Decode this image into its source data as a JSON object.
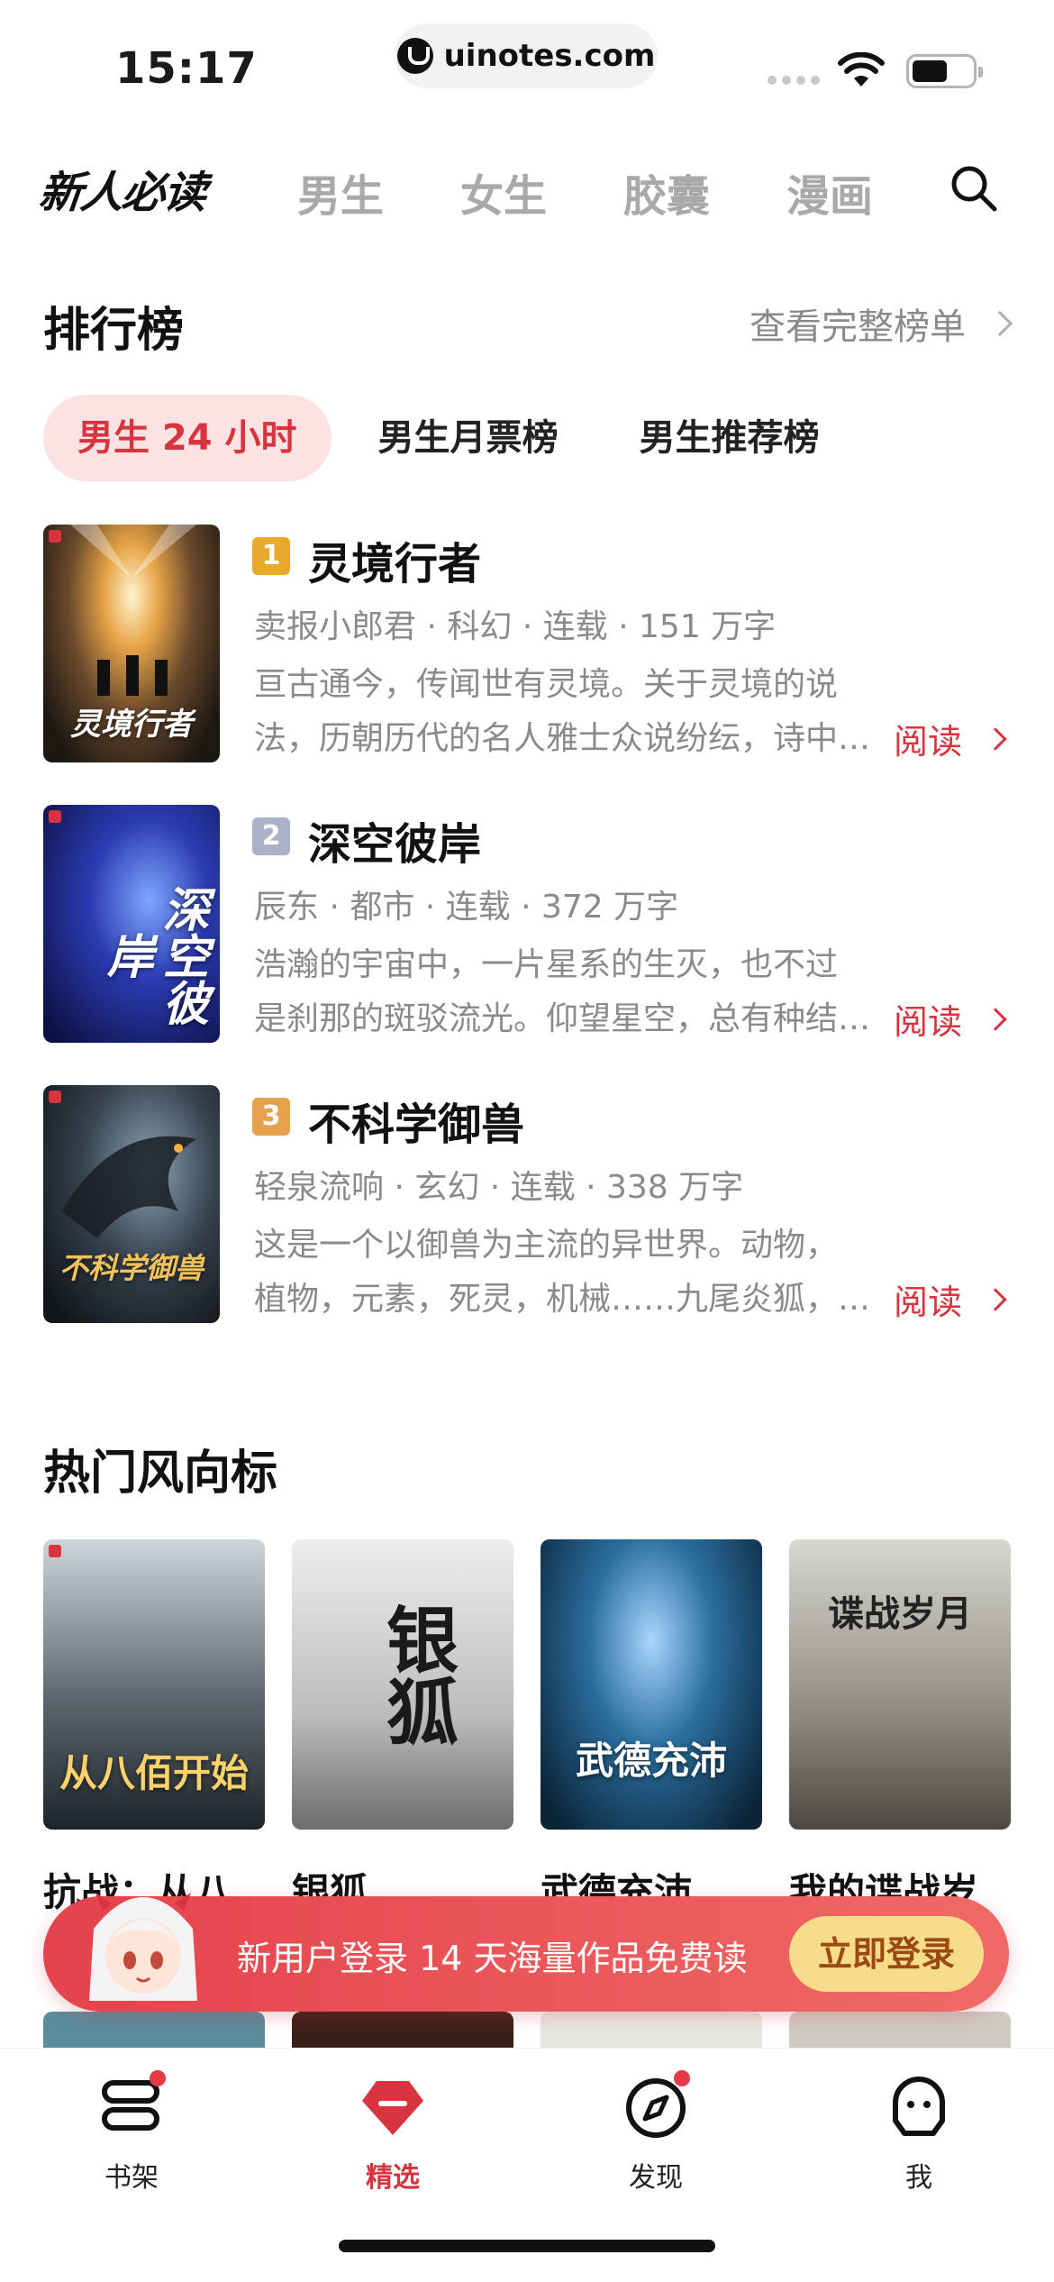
{
  "status_bar": {
    "time": "15:17",
    "url": "uinotes.com",
    "battery_level": 0.6
  },
  "top_nav": {
    "brand": "新人必读",
    "tabs": [
      "男生",
      "女生",
      "胶囊",
      "漫画"
    ]
  },
  "ranking": {
    "title": "排行榜",
    "see_all": "查看完整榜单",
    "tabs": [
      "男生 24 小时",
      "男生月票榜",
      "男生推荐榜"
    ],
    "active_tab": 0,
    "books": [
      {
        "rank": "1",
        "title": "灵境行者",
        "meta": "卖报小郎君 · 科幻 · 连载 · 151 万字",
        "desc_line1": "亘古通今，传闻世有灵境。关于灵境的说",
        "desc_line2": "法，历朝历代的名人雅士众说纷纭，诗中…",
        "read": "阅读",
        "cover_text": "灵境行者"
      },
      {
        "rank": "2",
        "title": "深空彼岸",
        "meta": "辰东 · 都市 · 连载 · 372 万字",
        "desc_line1": "浩瀚的宇宙中，一片星系的生灭，也不过",
        "desc_line2": "是刹那的斑驳流光。仰望星空，总有种结…",
        "read": "阅读",
        "cover_text": "深空彼岸"
      },
      {
        "rank": "3",
        "title": "不科学御兽",
        "meta": "轻泉流响 · 玄幻 · 连载 · 338 万字",
        "desc_line1": "这是一个以御兽为主流的异世界。动物，",
        "desc_line2": "植物，元素，死灵，机械……九尾炎狐，…",
        "read": "阅读",
        "cover_text": "不科学御兽"
      }
    ]
  },
  "hot": {
    "title": "热门风向标",
    "items": [
      {
        "label": "抗战：从八",
        "cover_text": "从八佰开始"
      },
      {
        "label": "银狐",
        "cover_text": "银狐"
      },
      {
        "label": "武德充沛",
        "cover_text": "武德充沛"
      },
      {
        "label": "我的谍战岁",
        "cover_text": "谍战岁月"
      }
    ]
  },
  "login_banner": {
    "text": "新用户登录 14 天海量作品免费读",
    "button": "立即登录"
  },
  "tab_bar": {
    "items": [
      "书架",
      "精选",
      "发现",
      "我"
    ],
    "active": 1
  },
  "colors": {
    "accent": "#d8343f",
    "gold": "#e9a92b",
    "silver": "#a9b2c6",
    "bronze": "#e6a14d"
  }
}
